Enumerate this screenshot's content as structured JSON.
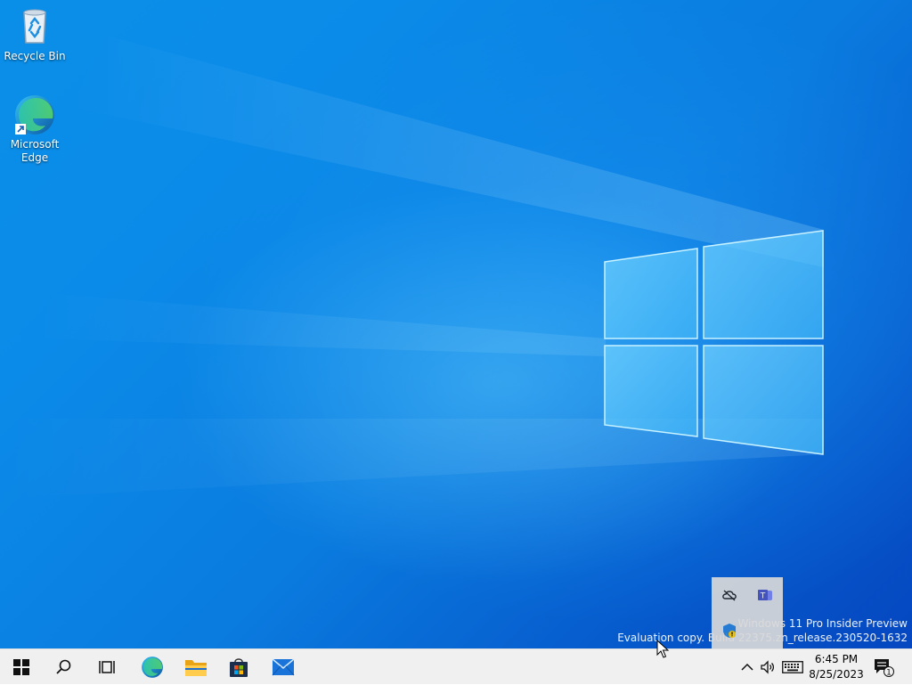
{
  "desktop": {
    "icons": [
      {
        "label": "Recycle Bin",
        "icon": "recycle-bin-icon"
      },
      {
        "label": "Microsoft\nEdge",
        "icon": "edge-icon"
      }
    ],
    "wallpaper": {
      "accent": "#0a8fe8",
      "dark": "#0547c0"
    }
  },
  "watermark": {
    "line1": "Windows 11 Pro Insider Preview",
    "line2": "Evaluation copy. Build 22375.zn_release.230520-1632"
  },
  "tray_overflow": {
    "icons": [
      "onedrive-offline-icon",
      "teams-icon",
      "windows-security-warning-icon"
    ]
  },
  "taskbar": {
    "pinned": [
      "start-icon",
      "search-icon",
      "task-view-icon",
      "edge-icon",
      "file-explorer-icon",
      "microsoft-store-icon",
      "mail-icon"
    ],
    "tray": [
      "chevron-up-icon",
      "volume-icon",
      "keyboard-icon"
    ],
    "clock": {
      "time": "6:45 PM",
      "date": "8/25/2023"
    },
    "notifications": {
      "count": "1"
    }
  }
}
